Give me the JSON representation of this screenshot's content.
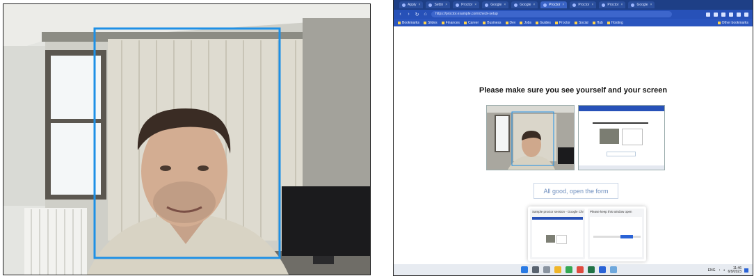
{
  "webcam": {
    "face_box_color": "#1e90e6"
  },
  "screen": {
    "tabs": [
      {
        "label": "Apply",
        "active": false
      },
      {
        "label": "Settin",
        "active": false
      },
      {
        "label": "Proctor",
        "active": false
      },
      {
        "label": "Google",
        "active": false
      },
      {
        "label": "Google",
        "active": false
      },
      {
        "label": "Proctor",
        "active": true
      },
      {
        "label": "Proctor",
        "active": false
      },
      {
        "label": "Proctor",
        "active": false
      },
      {
        "label": "Google",
        "active": false
      }
    ],
    "url": "https://proctor.example.com/check-setup",
    "bookmarks": [
      "Bookmarks",
      "Slides",
      "Finances",
      "Career",
      "Business",
      "Dev",
      "Jobs",
      "Guides",
      "Proctor",
      "Social",
      "Hub",
      "Hosting"
    ],
    "bookmarks_right": "Other bookmarks",
    "heading": "Please make sure you see yourself and your screen",
    "good_button": "All good, open the form",
    "popup_cards": [
      {
        "title": "Sample proctor session - Google Chrome"
      },
      {
        "title": "Please keep this window open"
      }
    ],
    "taskbar": {
      "tray": "ENG",
      "time": "11:46",
      "date": "6/9/2023"
    }
  }
}
